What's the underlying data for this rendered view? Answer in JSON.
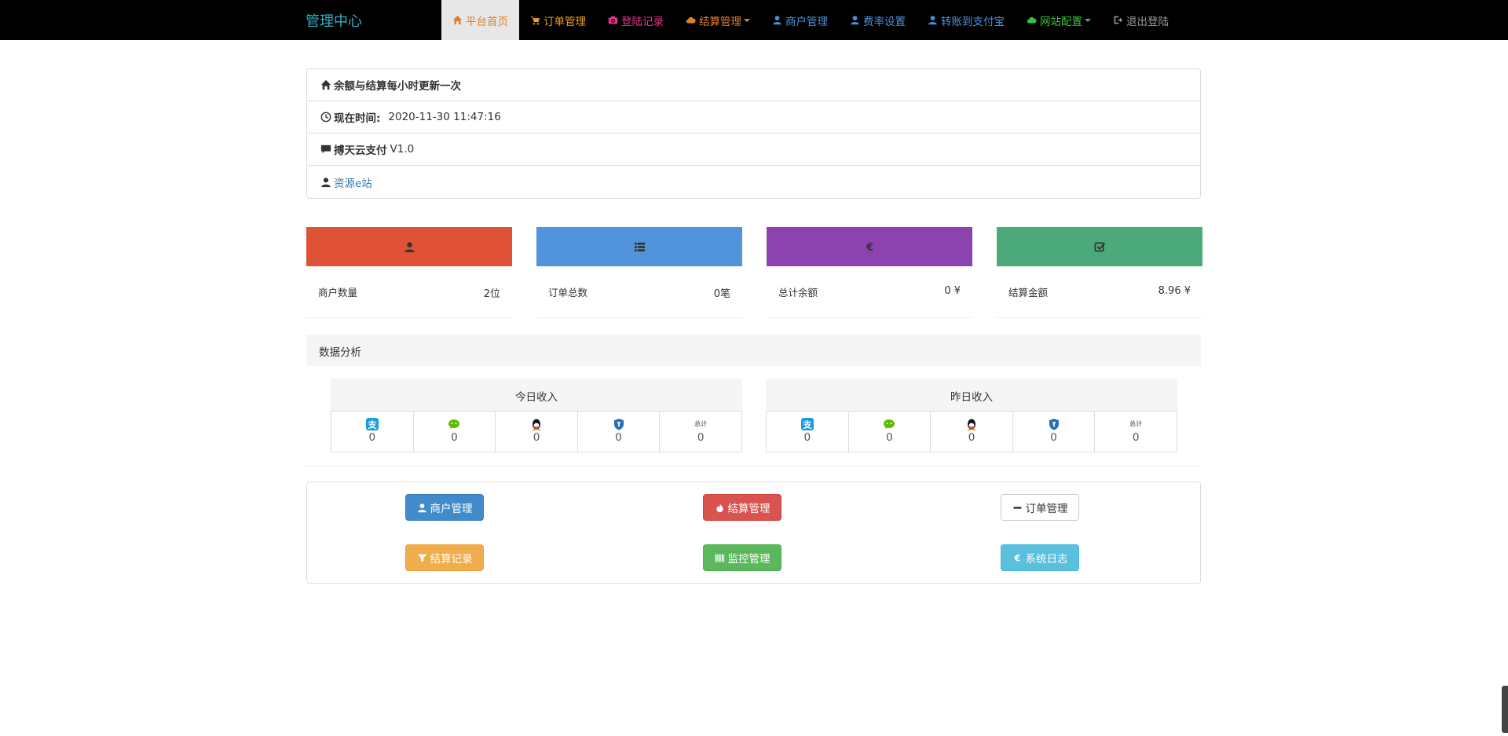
{
  "brand": "管理中心",
  "nav": [
    {
      "label": "平台首页",
      "color": "#e0802c",
      "icon": "home-icon",
      "active": true
    },
    {
      "label": "订单管理",
      "color": "#f0a020",
      "icon": "cart-icon"
    },
    {
      "label": "登陆记录",
      "color": "#e8338c",
      "icon": "camera-icon"
    },
    {
      "label": "结算管理",
      "color": "#e0802c",
      "icon": "cloud-icon",
      "dropdown": true
    },
    {
      "label": "商户管理",
      "color": "#4a90d9",
      "icon": "user-icon"
    },
    {
      "label": "费率设置",
      "color": "#4a90d9",
      "icon": "user-icon"
    },
    {
      "label": "转账到支付宝",
      "color": "#4a90d9",
      "icon": "user-icon"
    },
    {
      "label": "网站配置",
      "color": "#3cc13c",
      "icon": "cloud-icon",
      "dropdown": true
    },
    {
      "label": "退出登陆",
      "color": "#999999",
      "icon": "logout-icon"
    }
  ],
  "info": {
    "notice": "余额与结算每小时更新一次",
    "time_label": "现在时间:",
    "time_value": "2020-11-30 11:47:16",
    "product_name": "搏天云支付",
    "product_version": "V1.0",
    "site_link": "资源e站"
  },
  "stats": [
    {
      "label": "商户数量",
      "value": "2位",
      "color": "#e05235",
      "icon": "user-icon"
    },
    {
      "label": "订单总数",
      "value": "0笔",
      "color": "#5294dc",
      "icon": "list-icon"
    },
    {
      "label": "总计余额",
      "value": "0 ¥",
      "color": "#8c43b0",
      "icon": "euro-icon"
    },
    {
      "label": "结算金额",
      "value": "8.96 ¥",
      "color": "#4caa7a",
      "icon": "check-icon"
    }
  ],
  "analysis_title": "数据分析",
  "today": {
    "title": "今日收入",
    "cells": [
      {
        "icon": "alipay-icon",
        "value": "0"
      },
      {
        "icon": "wechat-icon",
        "value": "0"
      },
      {
        "icon": "qq-icon",
        "value": "0"
      },
      {
        "icon": "shield-icon",
        "value": "0"
      },
      {
        "text": "总计",
        "value": "0"
      }
    ]
  },
  "yesterday": {
    "title": "昨日收入",
    "cells": [
      {
        "icon": "alipay-icon",
        "value": "0"
      },
      {
        "icon": "wechat-icon",
        "value": "0"
      },
      {
        "icon": "qq-icon",
        "value": "0"
      },
      {
        "icon": "shield-icon",
        "value": "0"
      },
      {
        "text": "总计",
        "value": "0"
      }
    ]
  },
  "buttons": {
    "merchant": "商户管理",
    "settle": "结算管理",
    "order": "订单管理",
    "settle_log": "结算记录",
    "monitor": "监控管理",
    "syslog": "系统日志"
  }
}
